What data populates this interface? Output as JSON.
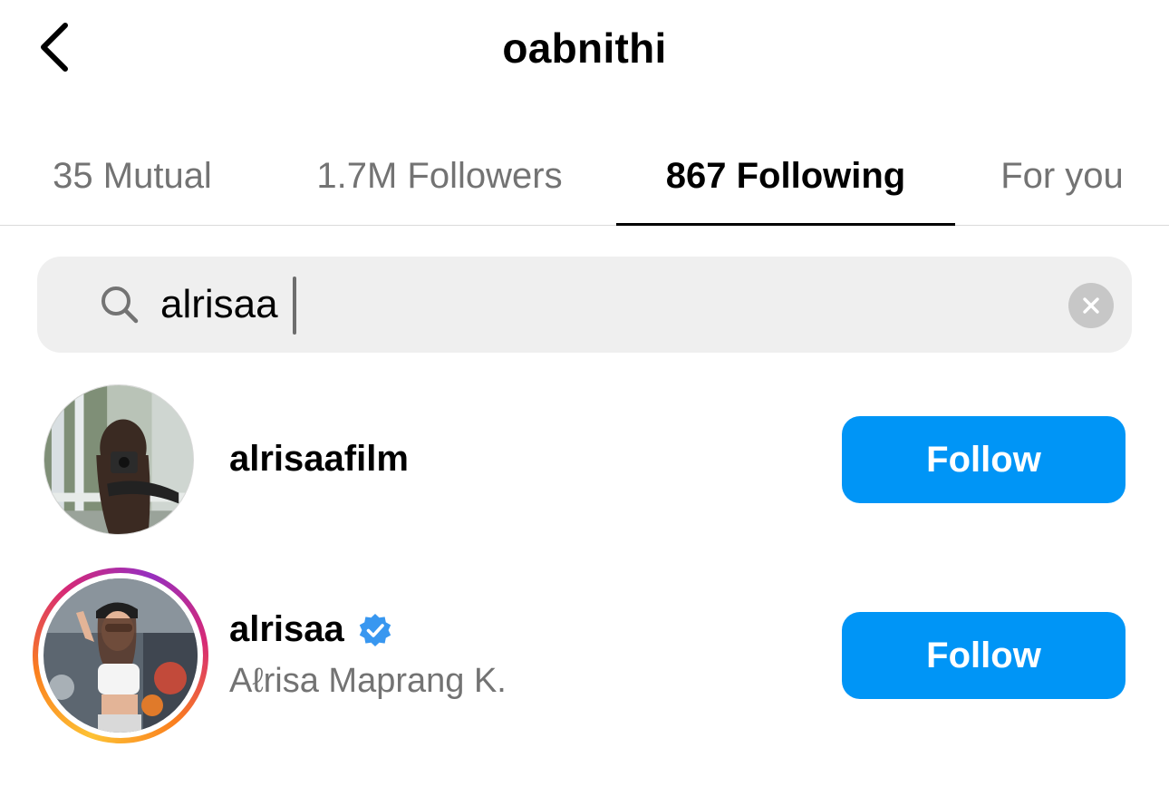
{
  "header": {
    "title": "oabnithi",
    "back_icon": "chevron-left-icon"
  },
  "tabs": [
    {
      "label": "35 Mutual",
      "active": false
    },
    {
      "label": "1.7M Followers",
      "active": false
    },
    {
      "label": "867 Following",
      "active": true
    },
    {
      "label": "For you",
      "active": false
    }
  ],
  "search": {
    "value": "alrisaa",
    "icon": "search-icon",
    "clear_icon": "clear-icon"
  },
  "results": [
    {
      "username": "alrisaafilm",
      "full_name": "",
      "verified": false,
      "has_story_ring": false,
      "button_label": "Follow"
    },
    {
      "username": "alrisaa",
      "full_name": "Aℓrisa Maprang K.",
      "verified": true,
      "has_story_ring": true,
      "button_label": "Follow"
    }
  ],
  "colors": {
    "accent": "#0095f6",
    "secondary_text": "#737373",
    "verified": "#3897f0",
    "search_bg": "#efefef"
  }
}
